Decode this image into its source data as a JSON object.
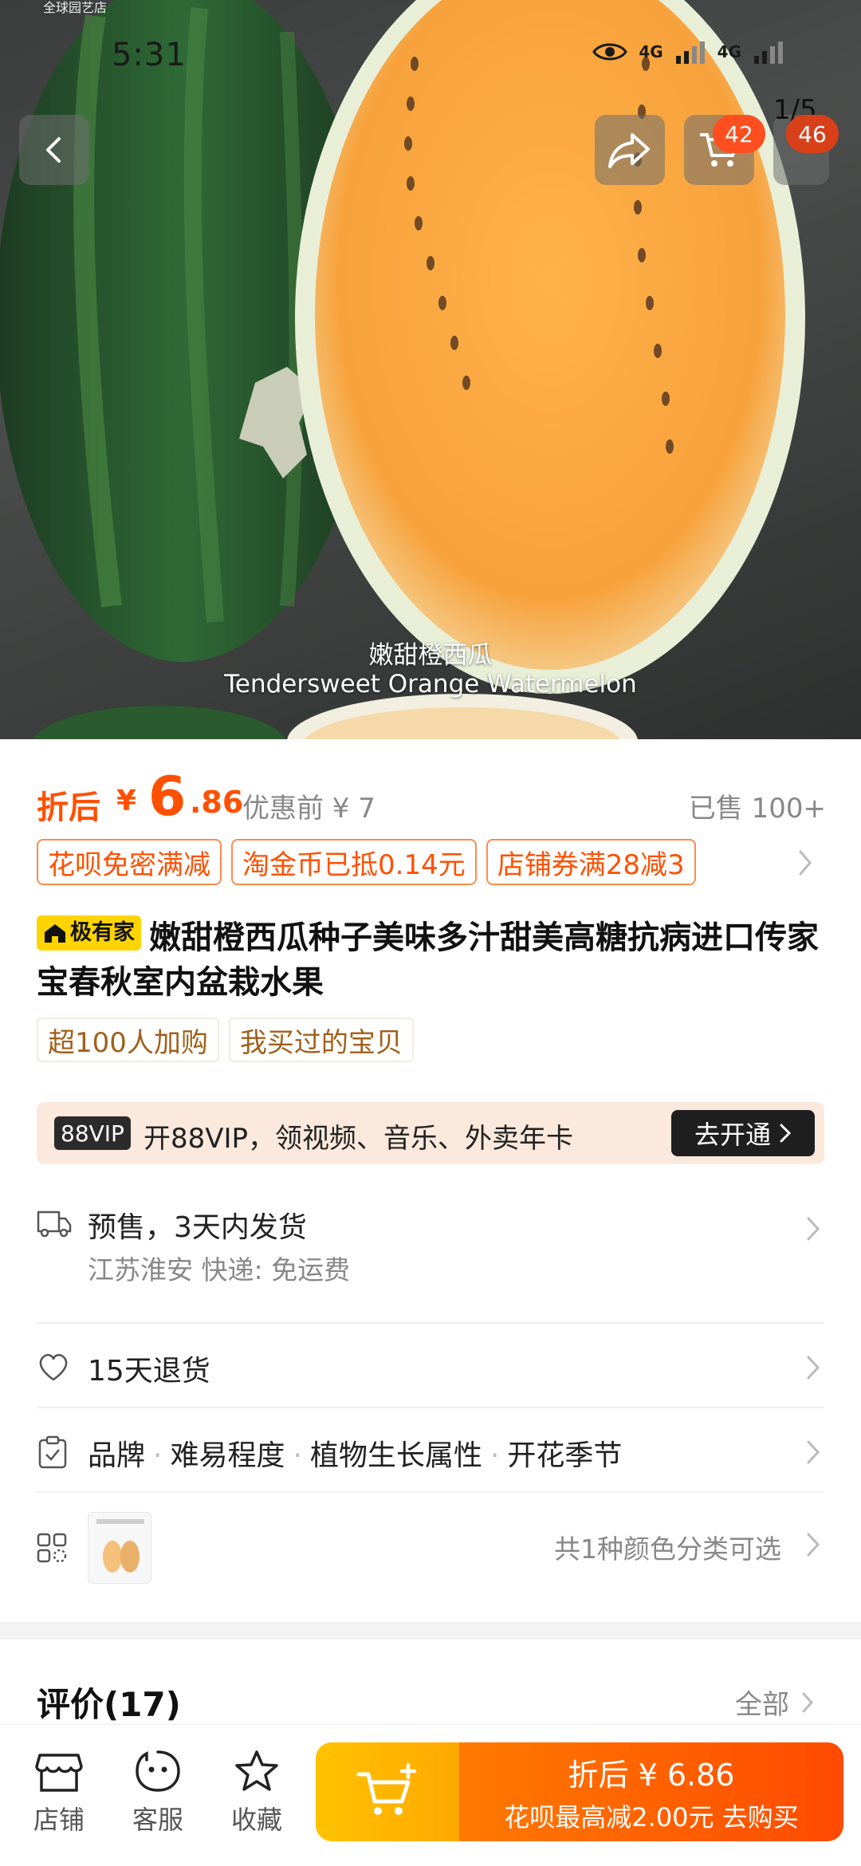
{
  "status_bar": {
    "time": "5:31",
    "net1": "4G",
    "net2": "4G"
  },
  "hero": {
    "shop_watermark": "全球园艺店",
    "page_indicator": "1/5",
    "cart_badge": "42",
    "msg_badge": "46",
    "caption_cn": "嫩甜橙西瓜",
    "caption_en": "Tendersweet Orange Watermelon"
  },
  "price": {
    "label": "折后",
    "currency": "¥",
    "integer": "6",
    "decimal": ".86",
    "original": "优惠前 ¥ 7",
    "sold": "已售 100+"
  },
  "coupons": [
    "花呗免密满减",
    "淘金币已抵0.14元",
    "店铺券满28减3"
  ],
  "title": {
    "brand_tag": "极有家",
    "text": "嫩甜橙西瓜种子美味多汁甜美高糖抗病进口传家宝春秋室内盆栽水果"
  },
  "chips": [
    "超100人加购",
    "我买过的宝贝"
  ],
  "vip": {
    "tag": "88VIP",
    "text": "开88VIP，领视频、音乐、外卖年卡",
    "button": "去开通"
  },
  "shipping": {
    "title": "预售，3天内发货",
    "sub": "江苏淮安  快递: 免运费"
  },
  "returns": {
    "title": "15天退货"
  },
  "params": [
    "品牌",
    "难易程度",
    "植物生长属性",
    "开花季节"
  ],
  "sku": {
    "text": "共1种颜色分类可选"
  },
  "reviews": {
    "title": "评价(17)",
    "all": "全部"
  },
  "bottom_bar": {
    "shop": "店铺",
    "service": "客服",
    "favorite": "收藏",
    "buy_line1": "折后 ¥ 6.86",
    "buy_line2": "花呗最高减2.00元  去购买"
  },
  "colors": {
    "accent": "#ff5000",
    "cta_yellow": "#ffb400",
    "cta_orange": "#ff5a00",
    "vip_bg": "#fbe9dd"
  }
}
